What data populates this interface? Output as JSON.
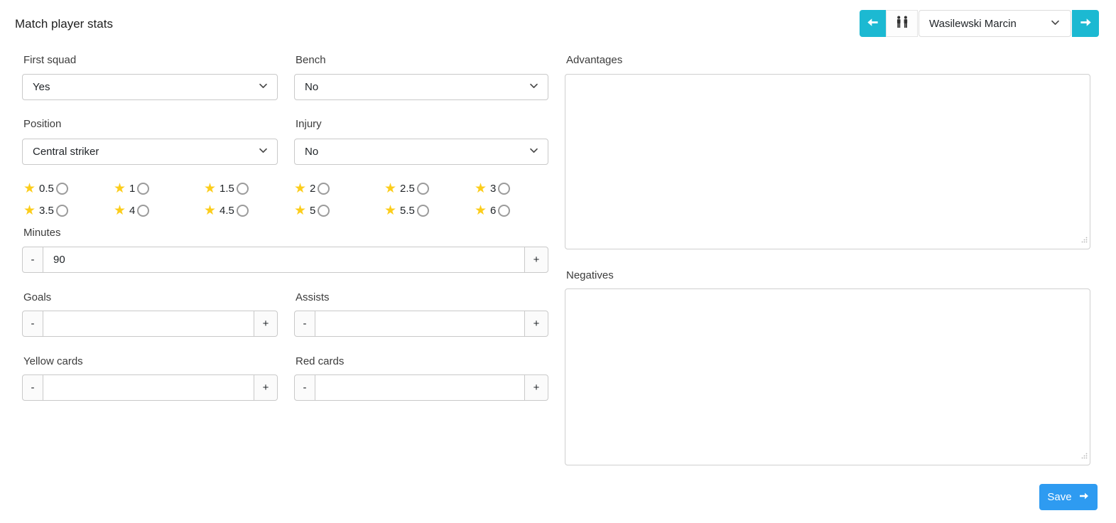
{
  "page": {
    "title": "Match player stats"
  },
  "header": {
    "prev_button_icon": "arrow-left",
    "players_button_icon": "people",
    "next_button_icon": "arrow-right",
    "player_select": {
      "value": "Wasilewski Marcin"
    }
  },
  "form": {
    "first_squad": {
      "label": "First squad",
      "value": "Yes"
    },
    "bench": {
      "label": "Bench",
      "value": "No"
    },
    "position": {
      "label": "Position",
      "value": "Central striker"
    },
    "injury": {
      "label": "Injury",
      "value": "No"
    },
    "rating": {
      "star_color": "#fccd1b",
      "options": [
        "0.5",
        "1",
        "1.5",
        "2",
        "2.5",
        "3",
        "3.5",
        "4",
        "4.5",
        "5",
        "5.5",
        "6"
      ],
      "selected": null
    },
    "minutes": {
      "label": "Minutes",
      "value": "90"
    },
    "goals": {
      "label": "Goals",
      "value": ""
    },
    "assists": {
      "label": "Assists",
      "value": ""
    },
    "yellow_cards": {
      "label": "Yellow cards",
      "value": ""
    },
    "red_cards": {
      "label": "Red cards",
      "value": ""
    },
    "advantages": {
      "label": "Advantages",
      "value": ""
    },
    "negatives": {
      "label": "Negatives",
      "value": ""
    },
    "stepper": {
      "minus": "-",
      "plus": "+"
    }
  },
  "footer": {
    "save": {
      "label": "Save",
      "icon": "arrow-right"
    }
  },
  "colors": {
    "accent_cyan": "#1cb9d2",
    "save_blue": "#2e9bf1",
    "star_yellow": "#fccd1b"
  }
}
